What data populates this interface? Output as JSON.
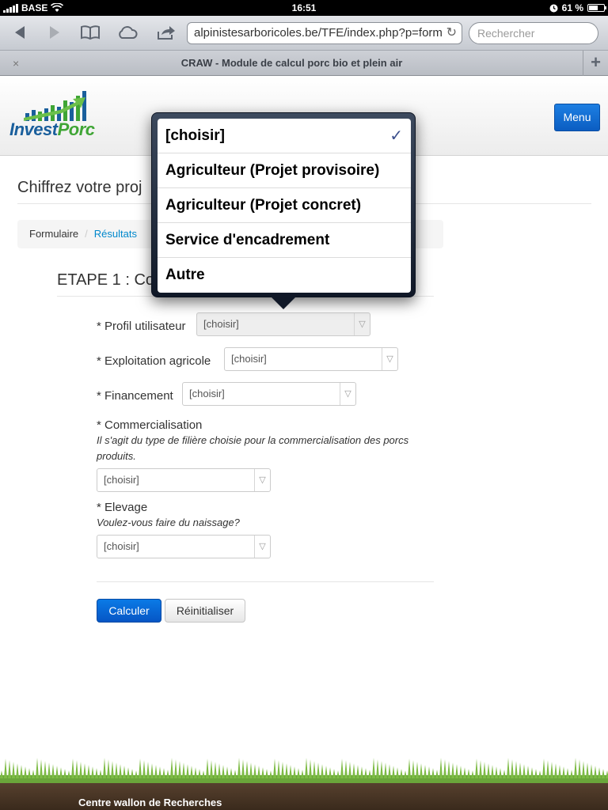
{
  "status": {
    "carrier": "BASE",
    "time": "16:51",
    "battery": "61 %",
    "battery_level": 0.61
  },
  "browser": {
    "url": "alpinistesarboricoles.be/TFE/index.php?p=form",
    "search_placeholder": "Rechercher",
    "tab_title": "CRAW - Module de calcul porc bio et plein air",
    "tab_close": "×",
    "new_tab": "+"
  },
  "header": {
    "logo_part1": "Invest",
    "logo_part2": "Porc",
    "menu_label": "Menu"
  },
  "main": {
    "page_title": "Chiffrez votre proj",
    "breadcrumb": {
      "home": "Formulaire",
      "separator": "/",
      "link": "Résultats"
    },
    "step_title": "ETAPE 1 : Co"
  },
  "form": {
    "fields": [
      {
        "label": "* Profil utilisateur",
        "value": "[choisir]",
        "help": ""
      },
      {
        "label": "* Exploitation agricole",
        "value": "[choisir]",
        "help": ""
      },
      {
        "label": "* Financement",
        "value": "[choisir]",
        "help": ""
      },
      {
        "label": "* Commercialisation",
        "value": "[choisir]",
        "help": "Il s'agit du type de filière choisie pour la commercialisation des porcs produits."
      },
      {
        "label": "* Elevage",
        "value": "[choisir]",
        "help": "Voulez-vous faire du naissage?"
      }
    ],
    "submit_label": "Calculer",
    "reset_label": "Réinitialiser"
  },
  "popover": {
    "options": [
      {
        "label": "[choisir]",
        "selected": true
      },
      {
        "label": "Agriculteur (Projet provisoire)",
        "selected": false
      },
      {
        "label": "Agriculteur (Projet concret)",
        "selected": false
      },
      {
        "label": "Service d'encadrement",
        "selected": false
      },
      {
        "label": "Autre",
        "selected": false
      }
    ],
    "check_glyph": "✓"
  },
  "footer": {
    "text": "Centre wallon de Recherches"
  },
  "colors": {
    "primary": "#0b5dc2",
    "link": "#0088cc",
    "logo_blue": "#1a5f9c",
    "logo_green": "#3fa535"
  }
}
